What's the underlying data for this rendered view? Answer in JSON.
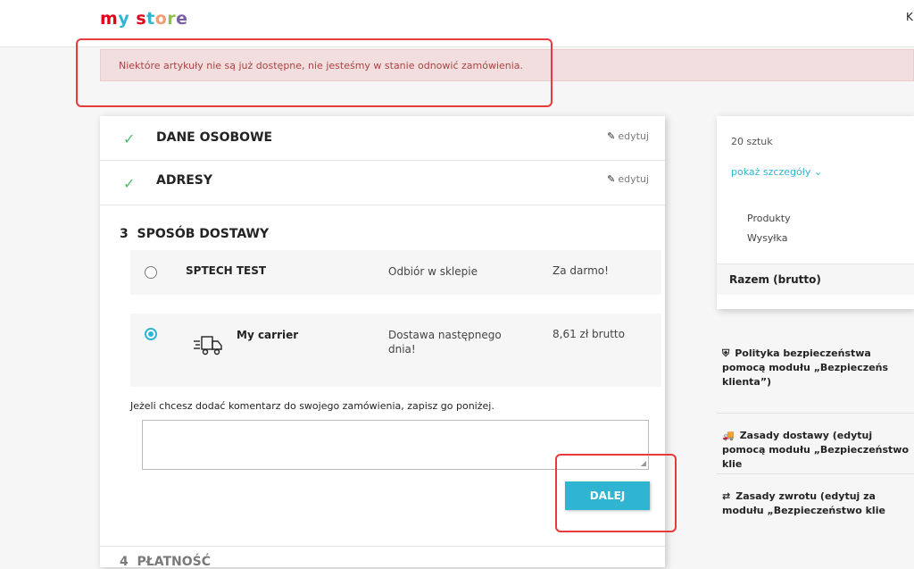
{
  "header": {
    "logo": [
      "my",
      " ",
      "store"
    ],
    "right_text": "K"
  },
  "alert": {
    "message": "Niektóre artykuły nie są już dostępne, nie jesteśmy w stanie odnowić zamówienia."
  },
  "steps": {
    "personal": {
      "title": "DANE OSOBOWE",
      "edit": "edytuj"
    },
    "addresses": {
      "title": "ADRESY",
      "edit": "edytuj"
    },
    "delivery": {
      "title": "3  SPOSÓB DOSTAWY",
      "options": [
        {
          "name": "SPTECH TEST",
          "delay": "Odbiór w sklepie",
          "price": "Za darmo!",
          "selected": false
        },
        {
          "name": "My carrier",
          "delay": "Dostawa następnego dnia!",
          "price": "8,61 zł brutto",
          "selected": true,
          "icon": "truck-icon"
        }
      ],
      "comment_label": "Jeżeli chcesz dodać komentarz do swojego zamówienia, zapisz go poniżej.",
      "comment_value": "",
      "continue_button": "DALEJ"
    },
    "payment": {
      "title": "4  PŁATNOŚĆ"
    }
  },
  "summary": {
    "count": "20 sztuk",
    "details_link": "pokaż szczegóły",
    "lines": [
      "Produkty",
      "Wysyłka"
    ],
    "total_label": "Razem (brutto)"
  },
  "reassurance": [
    {
      "icon": "shield-icon",
      "text": "Polityka bezpieczeństwa pomocą modułu „Bezpieczeńs klienta”)"
    },
    {
      "icon": "truck-icon",
      "text": "Zasady dostawy (edytuj pomocą modułu „Bezpieczeństwo klie"
    },
    {
      "icon": "swap-arrows-icon",
      "text": "Zasady zwrotu (edytuj za modułu „Bezpieczeństwo klie"
    }
  ],
  "colors": {
    "accent": "#2fb5d2",
    "alert_bg": "#f2dede",
    "alert_text": "#a94442",
    "check": "#4cbb6c",
    "highlight": "#e83a3a"
  }
}
